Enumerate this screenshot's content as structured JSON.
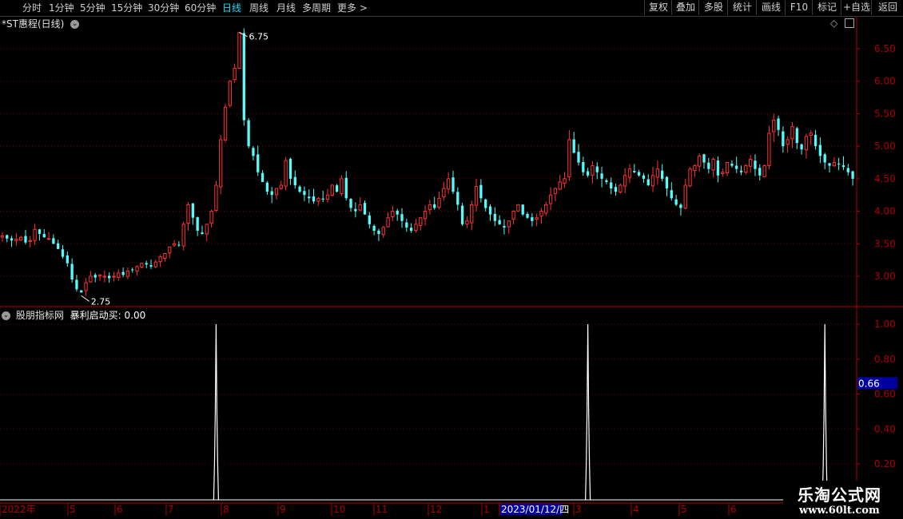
{
  "toolbar": {
    "periods": [
      "分时",
      "1分钟",
      "5分钟",
      "15分钟",
      "30分钟",
      "60分钟",
      "日线",
      "周线",
      "月线",
      "多周期",
      "更多 >"
    ],
    "active_index": 6,
    "right_buttons": [
      "复权",
      "叠加",
      "多股",
      "统计",
      "画线",
      "F10",
      "标记",
      "+自选",
      "返回"
    ]
  },
  "main_panel": {
    "title": "*ST惠程(日线)",
    "high_label": "6.75",
    "low_label": "2.75"
  },
  "indicator_panel": {
    "title": "股朋指标网",
    "indicator_name": "暴利启动买:",
    "indicator_value": "0.00",
    "cursor_value": "0.66"
  },
  "x_axis": {
    "labels": [
      "2022年",
      "5",
      "6",
      "7",
      "8",
      "9",
      "10",
      "11",
      "12",
      "1",
      "2023/01/12/四",
      "3",
      "4",
      "5",
      "6"
    ],
    "highlight_label": "2023/01/12/四"
  },
  "watermark": {
    "title": "乐淘公式网",
    "url": "www.60lt.com"
  },
  "colors": {
    "up": "#ff3232",
    "down": "#54fcfc",
    "grid": "#7a0000",
    "axis": "#b00000",
    "active": "#00e0ff",
    "signal": "#ffffff"
  },
  "chart_data": [
    {
      "type": "candlestick",
      "title": "*ST惠程(日线)",
      "ylim": [
        2.5,
        6.9
      ],
      "y_ticks": [
        3.0,
        3.5,
        4.0,
        4.5,
        5.0,
        5.5,
        6.0,
        6.5
      ],
      "x_ticks": [
        "2022年",
        "5",
        "6",
        "7",
        "8",
        "9",
        "10",
        "11",
        "12",
        "1",
        "2023/01/12/四",
        "3",
        "4",
        "5",
        "6"
      ],
      "series": [
        {
          "values": [
            3.62,
            3.58,
            3.55,
            3.57,
            3.6,
            3.52,
            3.55,
            3.72,
            3.65,
            3.6,
            3.58,
            3.5,
            3.42,
            3.3,
            3.2,
            2.95,
            2.8,
            2.75,
            2.9,
            3.0,
            2.98,
            3.02,
            3.0,
            2.97,
            3.0,
            3.05,
            3.02,
            3.08,
            3.1,
            3.15,
            3.2,
            3.18,
            3.15,
            3.22,
            3.3,
            3.35,
            3.45,
            3.5,
            3.48,
            3.8,
            4.1,
            3.9,
            3.7,
            3.65,
            3.8,
            4.0,
            4.4,
            5.1,
            5.6,
            6.0,
            6.2,
            6.75,
            5.4,
            5.0,
            4.85,
            4.6,
            4.45,
            4.3,
            4.25,
            4.35,
            4.4,
            4.78,
            4.5,
            4.4,
            4.3,
            4.25,
            4.2,
            4.15,
            4.2,
            4.18,
            4.25,
            4.4,
            4.3,
            4.5,
            4.2,
            4.05,
            4.0,
            4.1,
            3.95,
            3.8,
            3.7,
            3.65,
            3.75,
            3.9,
            4.0,
            3.95,
            3.85,
            3.75,
            3.7,
            3.8,
            3.9,
            4.0,
            4.1,
            4.05,
            4.2,
            4.35,
            4.5,
            4.3,
            4.1,
            3.8,
            3.85,
            4.1,
            4.38,
            4.2,
            4.05,
            3.95,
            3.85,
            3.8,
            3.75,
            3.85,
            4.0,
            4.1,
            3.95,
            3.9,
            3.85,
            3.9,
            4.0,
            4.1,
            4.25,
            4.35,
            4.45,
            4.5,
            5.1,
            4.9,
            4.75,
            4.6,
            4.55,
            4.7,
            4.6,
            4.5,
            4.45,
            4.35,
            4.3,
            4.4,
            4.55,
            4.65,
            4.6,
            4.55,
            4.5,
            4.4,
            4.55,
            4.65,
            4.5,
            4.35,
            4.2,
            4.1,
            4.05,
            4.4,
            4.65,
            4.7,
            4.85,
            4.75,
            4.65,
            4.8,
            4.55,
            4.6,
            4.75,
            4.7,
            4.65,
            4.6,
            4.7,
            4.8,
            4.65,
            4.55,
            4.7,
            5.2,
            5.4,
            5.25,
            5.0,
            5.1,
            5.3,
            5.05,
            4.95,
            5.15,
            5.2,
            5.0,
            4.85,
            4.75,
            4.7,
            4.75,
            4.72,
            4.68,
            4.6,
            4.5
          ]
        }
      ]
    },
    {
      "type": "line",
      "title": "暴利启动买",
      "ylim": [
        0.0,
        1.05
      ],
      "y_ticks": [
        0.2,
        0.4,
        0.6,
        0.8,
        1.0
      ],
      "series": [
        {
          "name": "暴利启动买",
          "signal_indices": [
            46,
            126,
            177
          ],
          "values_at_signals": [
            1.0,
            1.0,
            1.0
          ]
        }
      ]
    }
  ]
}
